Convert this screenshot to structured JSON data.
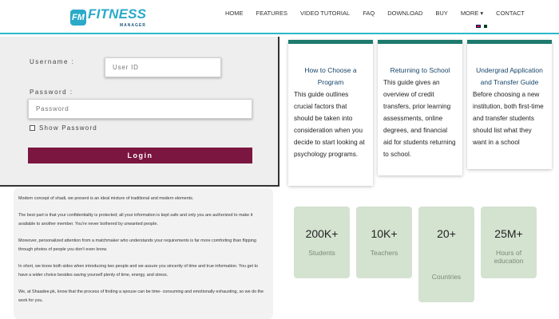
{
  "brand": {
    "badge": "FM",
    "name": "FITNESS",
    "subtitle": "MANAGER"
  },
  "nav": {
    "home": "HOME",
    "features": "FEATURES",
    "video_tutorial": "VIDEO TUTORIAL",
    "faq": "FAQ",
    "download": "DOWNLOAD",
    "buy": "BUY",
    "more": "MORE ▾",
    "contact": "CONTACT"
  },
  "login": {
    "username_label": "Username :",
    "username_placeholder": "User ID",
    "password_label": "Password :",
    "password_placeholder": "Password",
    "show_password": "Show Password",
    "button": "Login"
  },
  "article": {
    "p1": "Modern concept of shadi, we present is an ideal mixture of traditional and modern elements.",
    "p2": "The best part is that your confidentiality is protected; all your information is kept safe and only you are authorized to make it available to another member. You're never bothered by unwanted people.",
    "p3": "Moreover, personalized attention from a matchmaker who understands your requirements is far more comforting than flipping through photos of people you don't even know.",
    "p4": "In short, we know both sides when introducing two people and we assure you sincerity of time and true information. You get to have a wider choice besides saving yourself plenty of time, energy, and stress.",
    "p5": "We, at Shaadee.pk, know that the process of finding a spouse can be time- consuming and emotionally exhausting, so we do the work for you."
  },
  "cards": [
    {
      "title": "How to Choose a Program",
      "body": "This guide outlines crucial factors that should be taken into consideration when you decide to start looking at psychology programs."
    },
    {
      "title": "Returning to School",
      "body": "This guide gives an overview of credit transfers, prior learning assessments, online degrees, and financial aid for students returning to school."
    },
    {
      "title": "Undergrad Application and Transfer Guide",
      "body": "Before choosing a new institution, both first-time and transfer students should list what they want in a school"
    }
  ],
  "stats": [
    {
      "value": "200K+",
      "label": "Students"
    },
    {
      "value": "10K+",
      "label": "Teachers"
    },
    {
      "value": "20+",
      "label": "Countries"
    },
    {
      "value": "25M+",
      "label": "Hours of education"
    }
  ],
  "colors": {
    "accent": "#2ab8c9",
    "login_button": "#7b1640",
    "card_border": "#1e7a6e",
    "stat_bg": "#d4e2d0"
  }
}
